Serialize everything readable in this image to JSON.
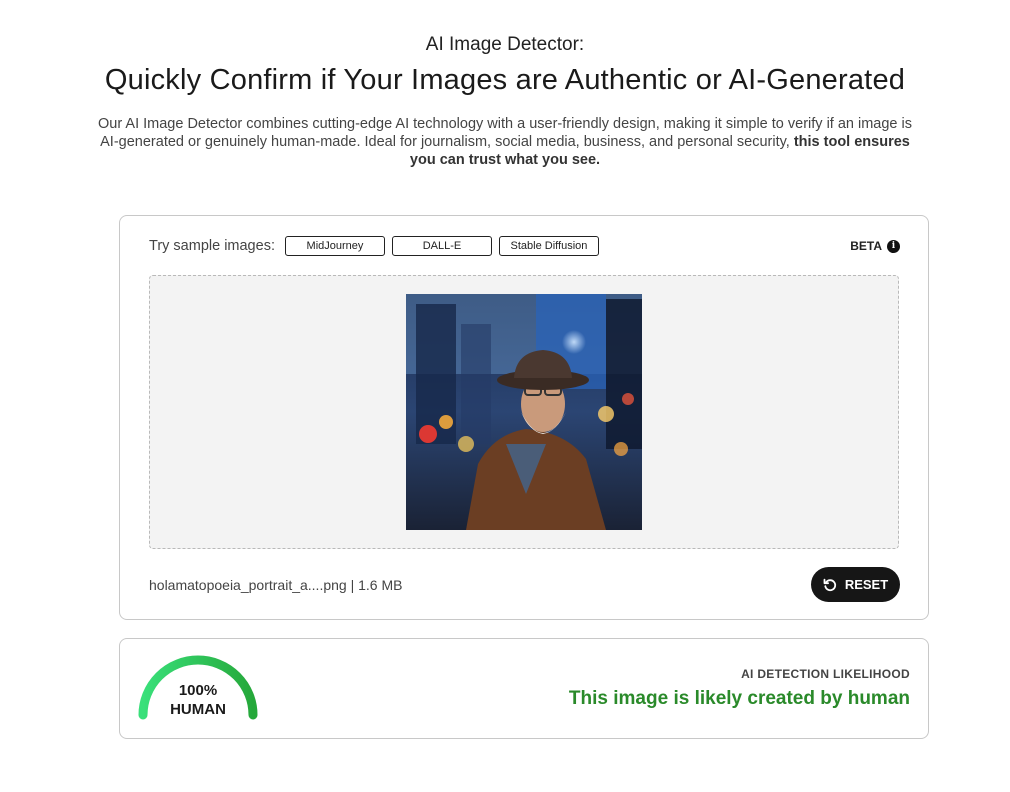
{
  "header": {
    "kicker": "AI Image Detector:",
    "title": "Quickly Confirm if Your Images are Authentic or AI-Generated",
    "description": "Our AI Image Detector combines cutting-edge AI technology with a user-friendly design, making it simple to verify if an image is AI-generated or genuinely human-made. Ideal for journalism, social media, business, and personal security,",
    "description_bold": "this tool ensures you can trust what you see."
  },
  "samples": {
    "label": "Try sample images:",
    "buttons": [
      "MidJourney",
      "DALL-E",
      "Stable Diffusion"
    ],
    "beta_label": "BETA",
    "info_icon": "info-icon"
  },
  "upload": {
    "file_info": "holamatopoeia_portrait_a....png | 1.6 MB",
    "reset_label": "RESET",
    "reset_icon": "reset-icon"
  },
  "result": {
    "percent_text": "100%",
    "class_text": "HUMAN",
    "human_fraction": 1.0,
    "likelihood_label": "AI DETECTION LIKELIHOOD",
    "verdict": "This image is likely created by human",
    "colors": {
      "verdict": "#2a8a2a",
      "gauge_start": "#39e07a",
      "gauge_end": "#25a83a"
    }
  }
}
